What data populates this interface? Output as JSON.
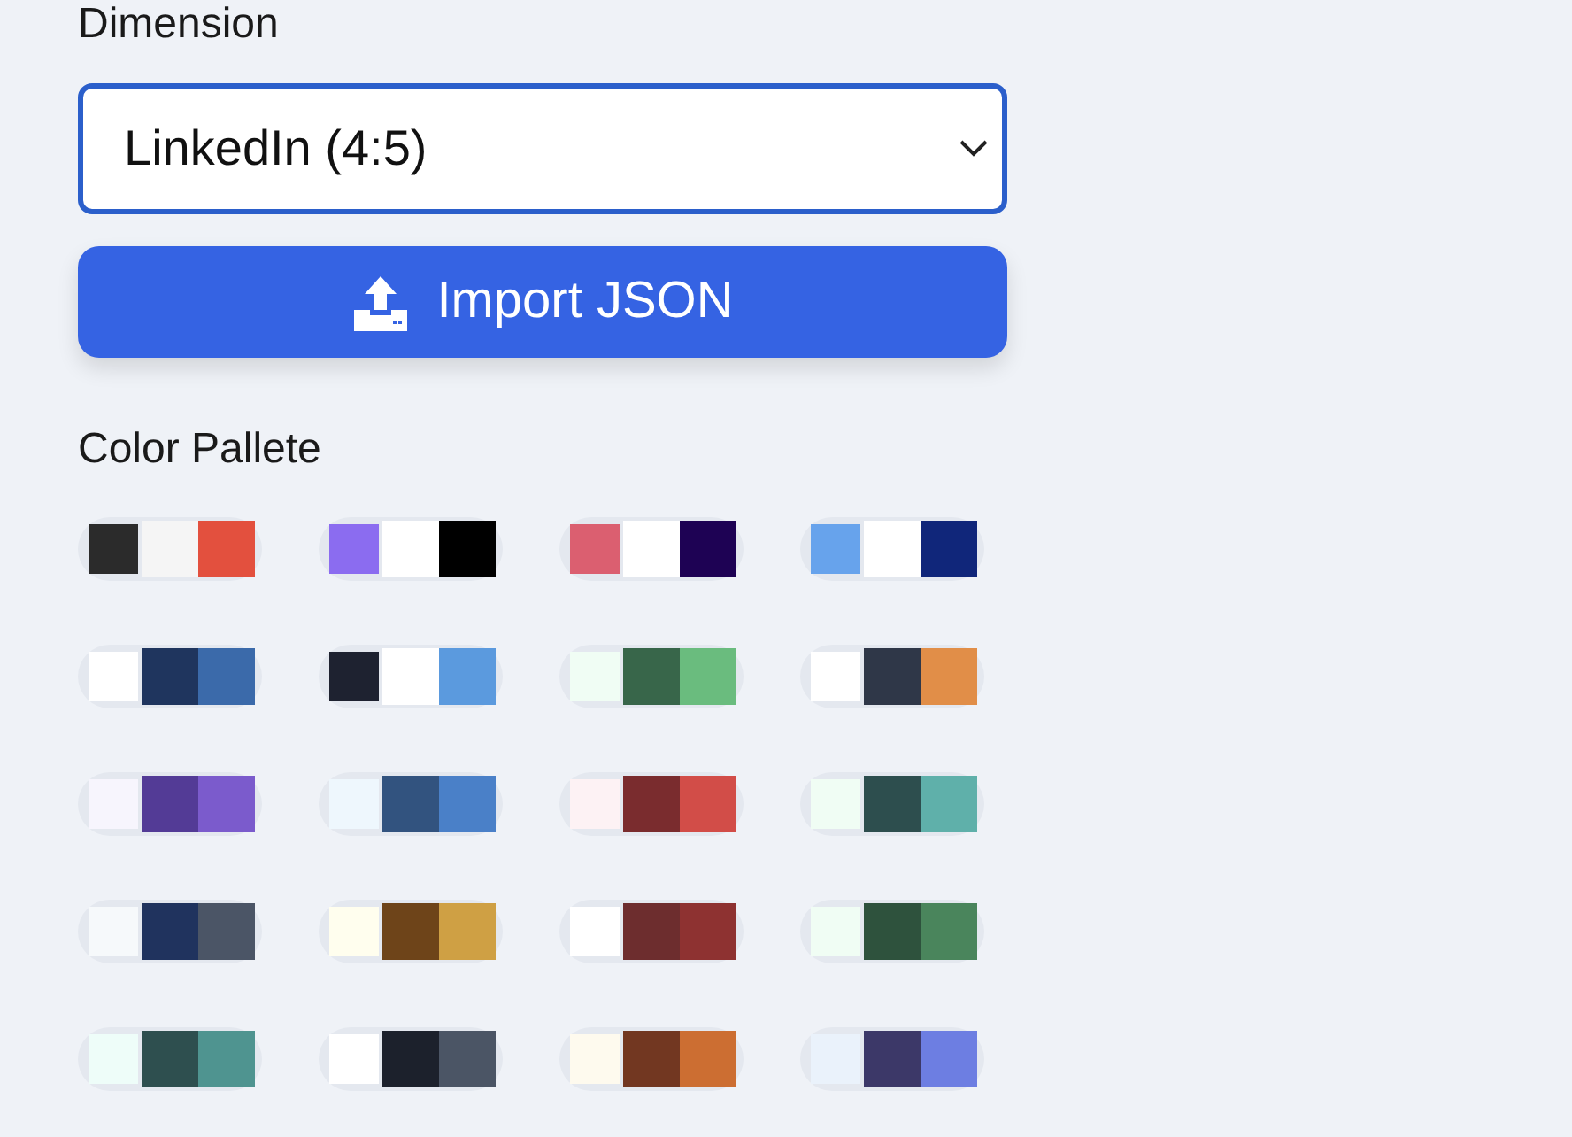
{
  "dimension": {
    "label": "Dimension",
    "value": "LinkedIn (4:5)"
  },
  "import_button": {
    "label": "Import JSON"
  },
  "palette_section": {
    "title": "Color Pallete",
    "palettes": [
      {
        "swatches": [
          {
            "color": "#2b2b2b"
          },
          {
            "color": "#f5f5f5"
          },
          {
            "color": "#e3503e"
          }
        ]
      },
      {
        "swatches": [
          {
            "color": "#8b6cf0"
          },
          {
            "color": "#ffffff"
          },
          {
            "color": "#000000"
          }
        ]
      },
      {
        "swatches": [
          {
            "color": "#db5f70"
          },
          {
            "color": "#ffffff"
          },
          {
            "color": "#1e0254"
          }
        ]
      },
      {
        "swatches": [
          {
            "color": "#67a3ec"
          },
          {
            "color": "#ffffff"
          },
          {
            "color": "#10267a"
          }
        ]
      },
      {
        "swatches": [
          {
            "color": "#ffffff"
          },
          {
            "color": "#1f355e"
          },
          {
            "color": "#3b6aaa"
          }
        ]
      },
      {
        "swatches": [
          {
            "color": "#1e2230"
          },
          {
            "color": "#ffffff"
          },
          {
            "color": "#5b9ade"
          }
        ]
      },
      {
        "swatches": [
          {
            "color": "#f0fdf4"
          },
          {
            "color": "#38664a"
          },
          {
            "color": "#6abc7e"
          }
        ]
      },
      {
        "swatches": [
          {
            "color": "#ffffff"
          },
          {
            "color": "#2f3748"
          },
          {
            "color": "#e18e48"
          }
        ]
      },
      {
        "swatches": [
          {
            "color": "#f7f5fd"
          },
          {
            "color": "#533b96"
          },
          {
            "color": "#7b5bcc"
          }
        ]
      },
      {
        "swatches": [
          {
            "color": "#eef7fd"
          },
          {
            "color": "#32537f"
          },
          {
            "color": "#4a80c8"
          }
        ]
      },
      {
        "swatches": [
          {
            "color": "#fdf2f4"
          },
          {
            "color": "#7a2c2e"
          },
          {
            "color": "#d24d48"
          }
        ]
      },
      {
        "swatches": [
          {
            "color": "#f0fdf4"
          },
          {
            "color": "#2d4e4e"
          },
          {
            "color": "#5fb0aa"
          }
        ]
      },
      {
        "swatches": [
          {
            "color": "#f6f9fb"
          },
          {
            "color": "#20335e"
          },
          {
            "color": "#4b5566"
          }
        ]
      },
      {
        "swatches": [
          {
            "color": "#fffeee"
          },
          {
            "color": "#6e4419"
          },
          {
            "color": "#cfa044"
          }
        ]
      },
      {
        "swatches": [
          {
            "color": "#ffffff"
          },
          {
            "color": "#6d2d2e"
          },
          {
            "color": "#8e3231"
          }
        ]
      },
      {
        "swatches": [
          {
            "color": "#f0fdf4"
          },
          {
            "color": "#2e523d"
          },
          {
            "color": "#4a855c"
          }
        ]
      },
      {
        "swatches": [
          {
            "color": "#eefdf9"
          },
          {
            "color": "#2e4f4f"
          },
          {
            "color": "#4f9490"
          }
        ]
      },
      {
        "swatches": [
          {
            "color": "#ffffff"
          },
          {
            "color": "#1c212c"
          },
          {
            "color": "#4b5565"
          }
        ]
      },
      {
        "swatches": [
          {
            "color": "#fefaee"
          },
          {
            "color": "#723721"
          },
          {
            "color": "#cc6e32"
          }
        ]
      },
      {
        "swatches": [
          {
            "color": "#eaf2fb"
          },
          {
            "color": "#3c3868"
          },
          {
            "color": "#6d7ee2"
          }
        ]
      }
    ]
  }
}
